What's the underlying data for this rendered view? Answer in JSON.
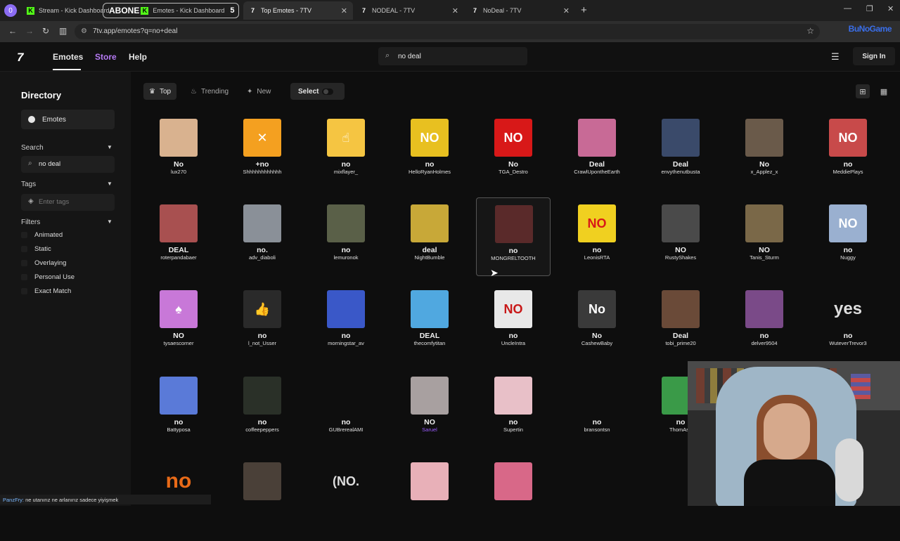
{
  "browser": {
    "profile_initial": "0",
    "tabs": [
      {
        "title": "Stream - Kick Dashboard",
        "favicon": "kick-icon",
        "color": "#53fc18"
      },
      {
        "title": "Emotes - Kick Dashboard",
        "prefix": "ABONE",
        "favicon": "kick-icon",
        "color": "#53fc18",
        "badge": "5"
      },
      {
        "title": "Top Emotes - 7TV",
        "favicon": "7tv-icon",
        "active": true
      },
      {
        "title": "NODEAL - 7TV",
        "favicon": "7tv-icon"
      },
      {
        "title": "NoDeal - 7TV",
        "favicon": "7tv-icon"
      }
    ],
    "url": "7tv.app/emotes?q=no+deal",
    "overlay_logo": "BuNoGame"
  },
  "nav": {
    "logo": "7",
    "links": [
      "Emotes",
      "Store",
      "Help"
    ],
    "search_value": "no deal",
    "sign_in": "Sign In"
  },
  "sidebar": {
    "title": "Directory",
    "emotes_label": "Emotes",
    "search_section": "Search",
    "search_value": "no deal",
    "tags_section": "Tags",
    "tags_placeholder": "Enter tags",
    "filters_section": "Filters",
    "filters": [
      "Animated",
      "Static",
      "Overlaying",
      "Personal Use",
      "Exact Match"
    ]
  },
  "toolbar": {
    "top": "Top",
    "trending": "Trending",
    "new": "New",
    "select": "Select"
  },
  "emotes": [
    {
      "name": "No",
      "owner": "lux270",
      "thumb": "face-icon",
      "bg": "#d9b28f"
    },
    {
      "name": "+no",
      "owner": "Shhhhhhhhhhhh",
      "thumb": "angry-emoji-icon",
      "bg": "#f4a020"
    },
    {
      "name": "no",
      "owner": "mixflayer_",
      "thumb": "finger-wag-icon",
      "bg": "#f5c542"
    },
    {
      "name": "no",
      "owner": "HelloRyanHolmes",
      "thumb": "pepe-no-icon",
      "bg": "#e8c020"
    },
    {
      "name": "No",
      "owner": "TGA_Destro",
      "thumb": "no-sign-icon",
      "bg": "#d81818"
    },
    {
      "name": "Deal",
      "owner": "CrawlUpontheEarth",
      "thumb": "pink-image-icon",
      "bg": "#c86a96"
    },
    {
      "name": "Deal",
      "owner": "envythenutbusta",
      "thumb": "deal-photo-icon",
      "bg": "#3a4a6a"
    },
    {
      "name": "No",
      "owner": "x_Applez_x",
      "thumb": "office-photo-icon",
      "bg": "#6a5a4a"
    },
    {
      "name": "no",
      "owner": "MeddiePlays",
      "thumb": "anime-no-icon",
      "bg": "#c84a4a"
    },
    {
      "name": "DEAL",
      "owner": "roterpandabaer",
      "thumb": "handshake-icon",
      "bg": "#a85050"
    },
    {
      "name": "no.",
      "owner": "adv_diaboli",
      "thumb": "dog-photo-icon",
      "bg": "#8a9098"
    },
    {
      "name": "no",
      "owner": "lemuronok",
      "thumb": "lemur-icon",
      "bg": "#5a6048"
    },
    {
      "name": "deal",
      "owner": "NightBumble",
      "thumb": "faces-icon",
      "bg": "#c8a838"
    },
    {
      "name": "no",
      "owner": "MONGRELTOOTH",
      "thumb": "creature-icon",
      "bg": "#5a2a2a",
      "hover": true
    },
    {
      "name": "no",
      "owner": "LeonisRTA",
      "thumb": "yellow-no-icon",
      "bg": "#f0d020"
    },
    {
      "name": "NO",
      "owner": "RustyShakes",
      "thumb": "shouting-man-icon",
      "bg": "#4a4a4a"
    },
    {
      "name": "NO",
      "owner": "Tanis_Sturm",
      "thumb": "soldier-icon",
      "bg": "#7a6848"
    },
    {
      "name": "no",
      "owner": "Nuggy",
      "thumb": "anime-girl-no-icon",
      "bg": "#9ab0d0"
    },
    {
      "name": "NO",
      "owner": "tysaescorner",
      "thumb": "spray-bottle-icon",
      "bg": "#c878d8"
    },
    {
      "name": "no",
      "owner": "l_not_Usser",
      "thumb": "thumbs-emoji-icon",
      "bg": "#2a2a2a"
    },
    {
      "name": "no",
      "owner": "morningstar_av",
      "thumb": "pointing-man-icon",
      "bg": "#3a58c8"
    },
    {
      "name": "DEAL",
      "owner": "thecomfytitan",
      "thumb": "cartoon-hat-icon",
      "bg": "#50a8e0"
    },
    {
      "name": "no",
      "owner": "UncleIntra",
      "thumb": "panda-no-icon",
      "bg": "#e8e8e8"
    },
    {
      "name": "No",
      "owner": "CashewBaby",
      "thumb": "emoji-no-icon",
      "bg": "#3a3a3a"
    },
    {
      "name": "Deal",
      "owner": "tobi_prime20",
      "thumb": "handshake-photo-icon",
      "bg": "#6a4a38"
    },
    {
      "name": "no",
      "owner": "delver9504",
      "thumb": "woman-photo-icon",
      "bg": "#7a4a88"
    },
    {
      "name": "no",
      "owner": "WuteverTrevor3",
      "thumb": "yes-text-icon",
      "bg": "transparent"
    },
    {
      "name": "no",
      "owner": "Battyposa",
      "thumb": "pony-icon",
      "bg": "#5a7ad8"
    },
    {
      "name": "no",
      "owner": "coffeepeppers",
      "thumb": "dark-photo-icon",
      "bg": "#2a3028"
    },
    {
      "name": "no",
      "owner": "GUBrerealAMI",
      "thumb": "small-icon",
      "bg": "transparent"
    },
    {
      "name": "NO",
      "owner": "Saruel",
      "thumb": "anime-grey-icon",
      "bg": "#a8a0a0",
      "owner_purple": true
    },
    {
      "name": "no",
      "owner": "Supertin",
      "thumb": "anime-pink-icon",
      "bg": "#e8c0c8"
    },
    {
      "name": "no",
      "owner": "bransontsn",
      "thumb": "tiny-figure-icon",
      "bg": "transparent"
    },
    {
      "name": "no",
      "owner": "ThomAsp",
      "thumb": "frog-icon",
      "bg": "#3a9a48"
    },
    {
      "name": "",
      "owner": "",
      "thumb": "anime-no-icon",
      "bg": "#b84a4a"
    },
    {
      "name": "",
      "owner": "",
      "thumb": "luigi-icon",
      "bg": "#3a6a98"
    },
    {
      "name": "",
      "owner": "",
      "thumb": "no-orange-text-icon",
      "bg": "transparent"
    },
    {
      "name": "",
      "owner": "",
      "thumb": "cat-photo-icon",
      "bg": "#4a4038"
    },
    {
      "name": "",
      "owner": "",
      "thumb": "no-paren-text-icon",
      "bg": "transparent"
    },
    {
      "name": "",
      "owner": "",
      "thumb": "pink-cartoon-icon",
      "bg": "#e8b0b8"
    },
    {
      "name": "",
      "owner": "",
      "thumb": "face-pink-icon",
      "bg": "#d86888"
    }
  ],
  "ticker": {
    "user": "PanzFry:",
    "message": "ne utanırız ne arlanırız sadece yiyişmek"
  }
}
